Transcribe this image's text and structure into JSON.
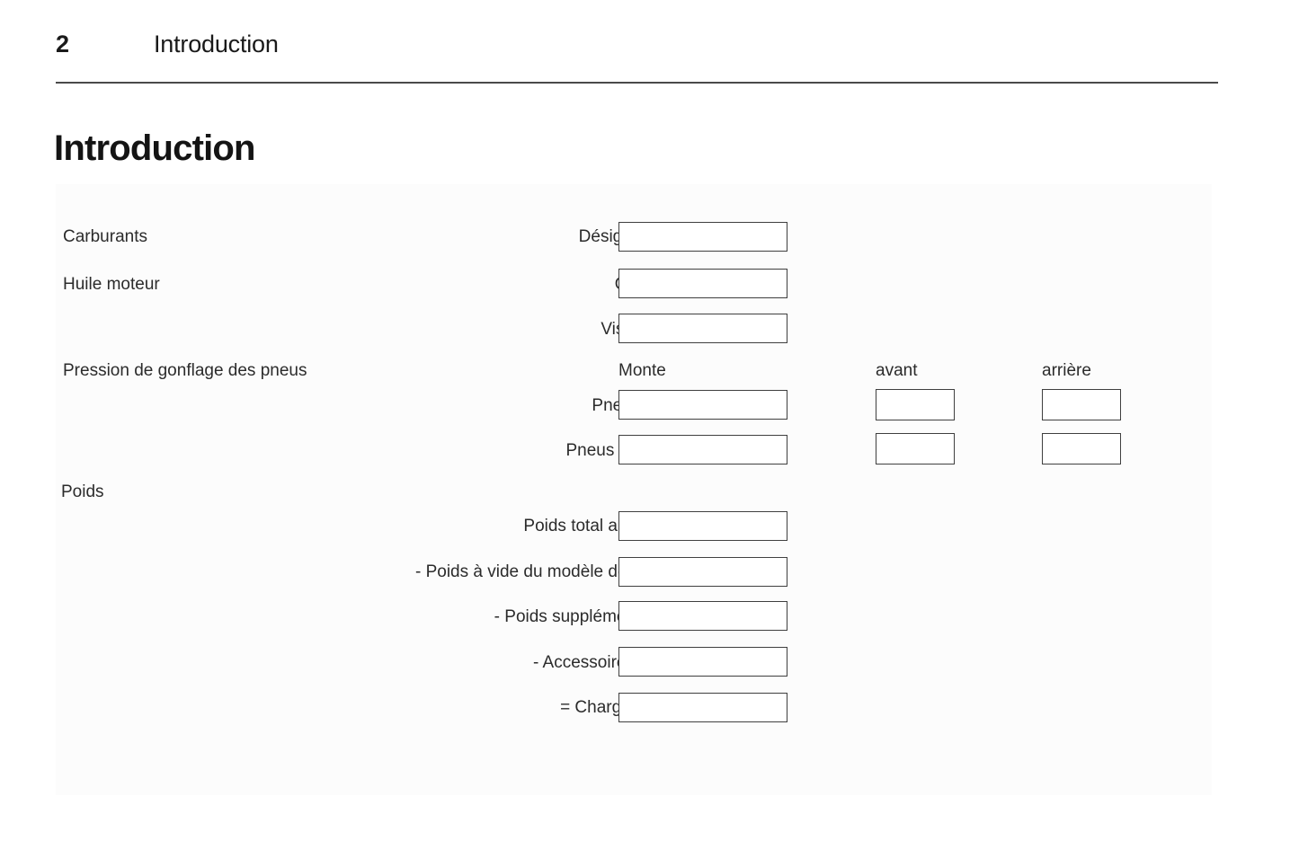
{
  "header": {
    "page_number": "2",
    "chapter": "Introduction"
  },
  "section": {
    "title": "Introduction"
  },
  "form": {
    "group_labels": [
      {
        "text": "Carburants"
      },
      {
        "text": "Huile moteur"
      },
      {
        "text": "Pression de gonflage des pneus"
      },
      {
        "text": "Poids"
      }
    ],
    "column_headers": [
      {
        "text": "Monte"
      },
      {
        "text": "avant"
      },
      {
        "text": "arrière"
      }
    ],
    "rows": [
      {
        "label": "Désignation",
        "value": "",
        "placeholder": ""
      },
      {
        "label": "Qualité",
        "value": "",
        "placeholder": ""
      },
      {
        "label": "Viscosité",
        "value": "",
        "placeholder": ""
      },
      {
        "label": "Pneus été",
        "value": "",
        "placeholder": "",
        "front": "",
        "rear": ""
      },
      {
        "label": "Pneus d'hiver",
        "value": "",
        "placeholder": "",
        "front": "",
        "rear": ""
      },
      {
        "label": "Poids total autorisé",
        "value": "",
        "placeholder": ""
      },
      {
        "label": "- Poids à vide du modèle de base",
        "value": "",
        "placeholder": ""
      },
      {
        "label": "- Poids supplémentaire",
        "value": "",
        "placeholder": ""
      },
      {
        "label": "- Accessoire lourd",
        "value": "",
        "placeholder": ""
      },
      {
        "label": "= Chargement",
        "value": "",
        "placeholder": ""
      }
    ]
  },
  "colors": {
    "text": "#2b2b2b",
    "heading": "#141414",
    "rule": "#4a4a4a",
    "box_border": "#3f3f3f",
    "panel_bg": "#fcfcfc",
    "page_bg": "#ffffff"
  }
}
